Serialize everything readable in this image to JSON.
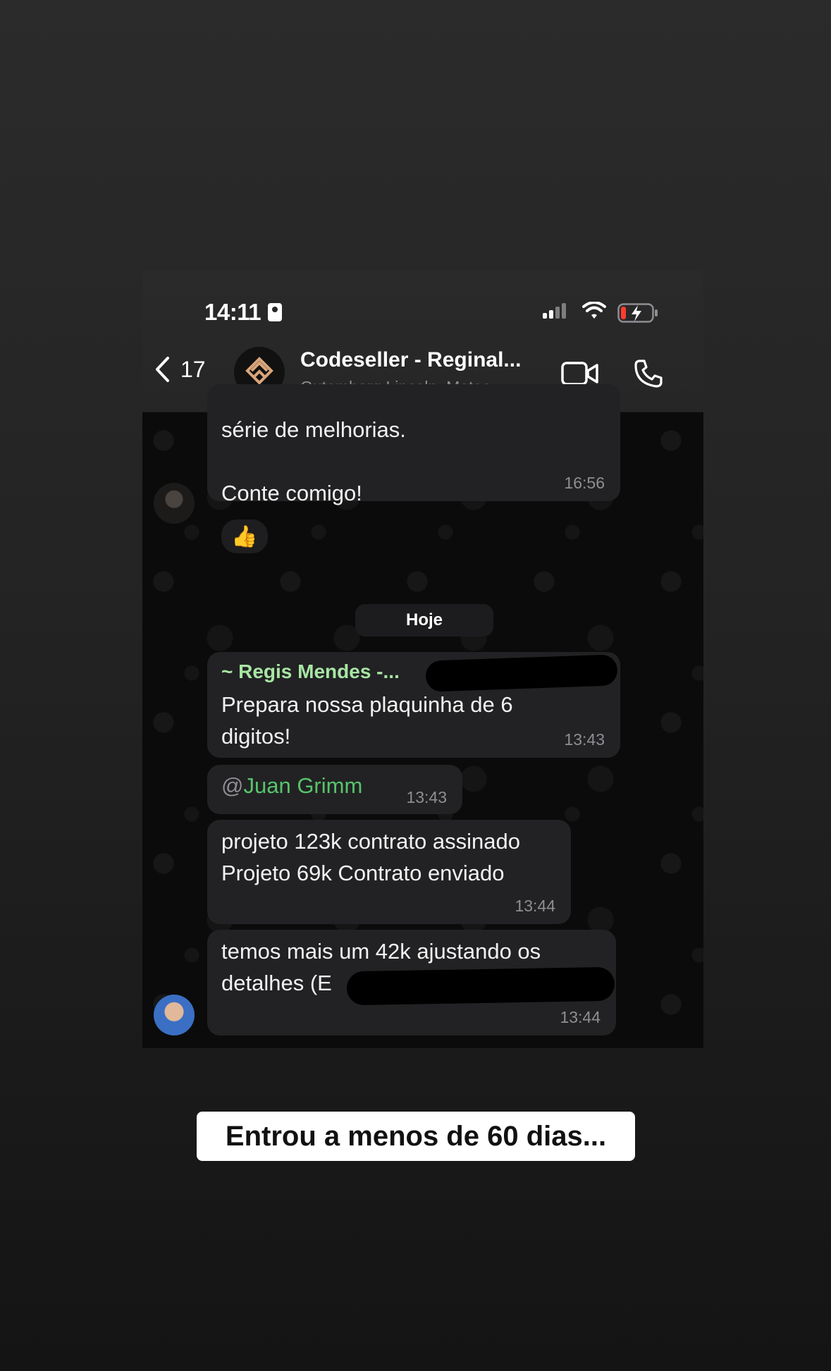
{
  "status_bar": {
    "time": "14:11"
  },
  "header": {
    "back_count": "17",
    "group_title": "Codeseller - Reginal...",
    "group_members": "Gutemberg Lincoln, Mateo, ~..."
  },
  "messages": {
    "m1": {
      "text": "série de melhorias.\n\nConte comigo!",
      "time": "16:56",
      "reaction": "👍"
    },
    "date_separator": "Hoje",
    "m2": {
      "sender": "~ Regis Mendes -...",
      "text": "Prepara nossa plaquinha de 6\ndigitos!",
      "time": "13:43"
    },
    "m3": {
      "mention_at": "@",
      "mention_name": "Juan Grimm",
      "time": "13:43"
    },
    "m4": {
      "text": "projeto 123k contrato assinado\nProjeto 69k Contrato enviado",
      "time": "13:44"
    },
    "m5": {
      "text": "temos mais um 42k ajustando os\ndetalhes (E",
      "time": "13:44"
    }
  },
  "caption": "Entrou a menos de 60 dias..."
}
